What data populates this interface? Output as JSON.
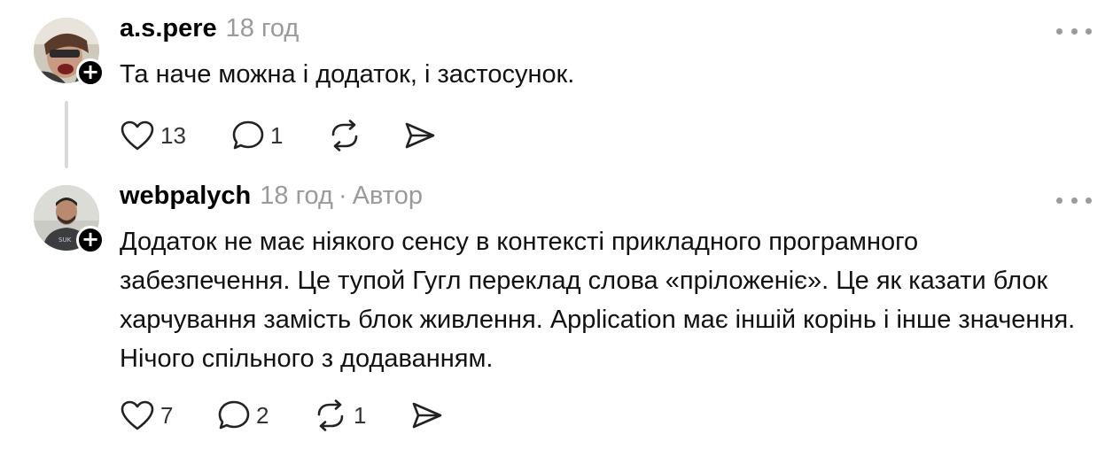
{
  "comments": [
    {
      "username": "a.s.pere",
      "time": "18 год",
      "text": "Та наче можна і додаток, і застосунок.",
      "likes": "13",
      "replies": "1",
      "reposts": "",
      "follow_symbol": "+"
    },
    {
      "username": "webpalych",
      "time": "18 год",
      "separator": "·",
      "author_label": "Автор",
      "text": "Додаток не має ніякого сенсу в контексті прикладного програмного забезпечення. Це тупой Гугл переклад слова «пріложеніє». Це як казати блок харчування замість блок живлення. Application має іншій корінь і інше значення. Нічого спільного з додаванням.",
      "likes": "7",
      "replies": "2",
      "reposts": "1",
      "follow_symbol": "+"
    }
  ],
  "icons": {
    "like": "heart-icon",
    "reply": "comment-bubble-icon",
    "repost": "repost-icon",
    "share": "send-icon",
    "more": "more-dots-icon",
    "follow": "plus-icon"
  }
}
